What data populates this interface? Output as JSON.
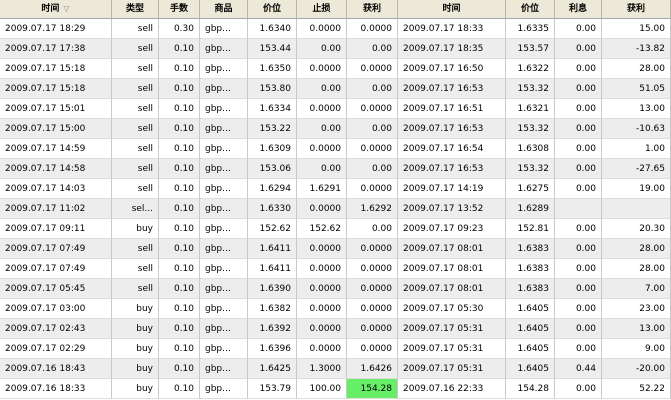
{
  "headers": [
    "时间",
    "类型",
    "手数",
    "商品",
    "价位",
    "止损",
    "获利",
    "时间",
    "价位",
    "利息",
    "获利"
  ],
  "sort_indicator": "▽",
  "rows": [
    [
      "2009.07.17 18:29",
      "sell",
      "0.30",
      "gbp...",
      "1.6340",
      "0.0000",
      "0.0000",
      "2009.07.17 18:33",
      "1.6335",
      "0.00",
      "15.00"
    ],
    [
      "2009.07.17 17:38",
      "sell",
      "0.10",
      "gbp...",
      "153.44",
      "0.00",
      "0.00",
      "2009.07.17 18:35",
      "153.57",
      "0.00",
      "-13.82"
    ],
    [
      "2009.07.17 15:18",
      "sell",
      "0.10",
      "gbp...",
      "1.6350",
      "0.0000",
      "0.0000",
      "2009.07.17 16:50",
      "1.6322",
      "0.00",
      "28.00"
    ],
    [
      "2009.07.17 15:18",
      "sell",
      "0.10",
      "gbp...",
      "153.80",
      "0.00",
      "0.00",
      "2009.07.17 16:53",
      "153.32",
      "0.00",
      "51.05"
    ],
    [
      "2009.07.17 15:01",
      "sell",
      "0.10",
      "gbp...",
      "1.6334",
      "0.0000",
      "0.0000",
      "2009.07.17 16:51",
      "1.6321",
      "0.00",
      "13.00"
    ],
    [
      "2009.07.17 15:00",
      "sell",
      "0.10",
      "gbp...",
      "153.22",
      "0.00",
      "0.00",
      "2009.07.17 16:53",
      "153.32",
      "0.00",
      "-10.63"
    ],
    [
      "2009.07.17 14:59",
      "sell",
      "0.10",
      "gbp...",
      "1.6309",
      "0.0000",
      "0.0000",
      "2009.07.17 16:54",
      "1.6308",
      "0.00",
      "1.00"
    ],
    [
      "2009.07.17 14:58",
      "sell",
      "0.10",
      "gbp...",
      "153.06",
      "0.00",
      "0.00",
      "2009.07.17 16:53",
      "153.32",
      "0.00",
      "-27.65"
    ],
    [
      "2009.07.17 14:03",
      "sell",
      "0.10",
      "gbp...",
      "1.6294",
      "1.6291",
      "0.0000",
      "2009.07.17 14:19",
      "1.6275",
      "0.00",
      "19.00"
    ],
    [
      "2009.07.17 11:02",
      "sel...",
      "0.10",
      "gbp...",
      "1.6330",
      "0.0000",
      "1.6292",
      "2009.07.17 13:52",
      "1.6289",
      "",
      ""
    ],
    [
      "2009.07.17 09:11",
      "buy",
      "0.10",
      "gbp...",
      "152.62",
      "152.62",
      "0.00",
      "2009.07.17 09:23",
      "152.81",
      "0.00",
      "20.30"
    ],
    [
      "2009.07.17 07:49",
      "sell",
      "0.10",
      "gbp...",
      "1.6411",
      "0.0000",
      "0.0000",
      "2009.07.17 08:01",
      "1.6383",
      "0.00",
      "28.00"
    ],
    [
      "2009.07.17 07:49",
      "sell",
      "0.10",
      "gbp...",
      "1.6411",
      "0.0000",
      "0.0000",
      "2009.07.17 08:01",
      "1.6383",
      "0.00",
      "28.00"
    ],
    [
      "2009.07.17 05:45",
      "sell",
      "0.10",
      "gbp...",
      "1.6390",
      "0.0000",
      "0.0000",
      "2009.07.17 08:01",
      "1.6383",
      "0.00",
      "7.00"
    ],
    [
      "2009.07.17 03:00",
      "buy",
      "0.10",
      "gbp...",
      "1.6382",
      "0.0000",
      "0.0000",
      "2009.07.17 05:30",
      "1.6405",
      "0.00",
      "23.00"
    ],
    [
      "2009.07.17 02:43",
      "buy",
      "0.10",
      "gbp...",
      "1.6392",
      "0.0000",
      "0.0000",
      "2009.07.17 05:31",
      "1.6405",
      "0.00",
      "13.00"
    ],
    [
      "2009.07.17 02:29",
      "buy",
      "0.10",
      "gbp...",
      "1.6396",
      "0.0000",
      "0.0000",
      "2009.07.17 05:31",
      "1.6405",
      "0.00",
      "9.00"
    ],
    [
      "2009.07.16 18:43",
      "buy",
      "0.10",
      "gbp...",
      "1.6425",
      "1.3000",
      "1.6426",
      "2009.07.17 05:31",
      "1.6405",
      "0.44",
      "-20.00"
    ],
    [
      "2009.07.16 18:33",
      "buy",
      "0.10",
      "gbp...",
      "153.79",
      "100.00",
      "154.28",
      "2009.07.16 22:33",
      "154.28",
      "0.00",
      "52.22"
    ]
  ],
  "highlight": {
    "row": 18,
    "col": 6,
    "color": "#66ee66"
  }
}
